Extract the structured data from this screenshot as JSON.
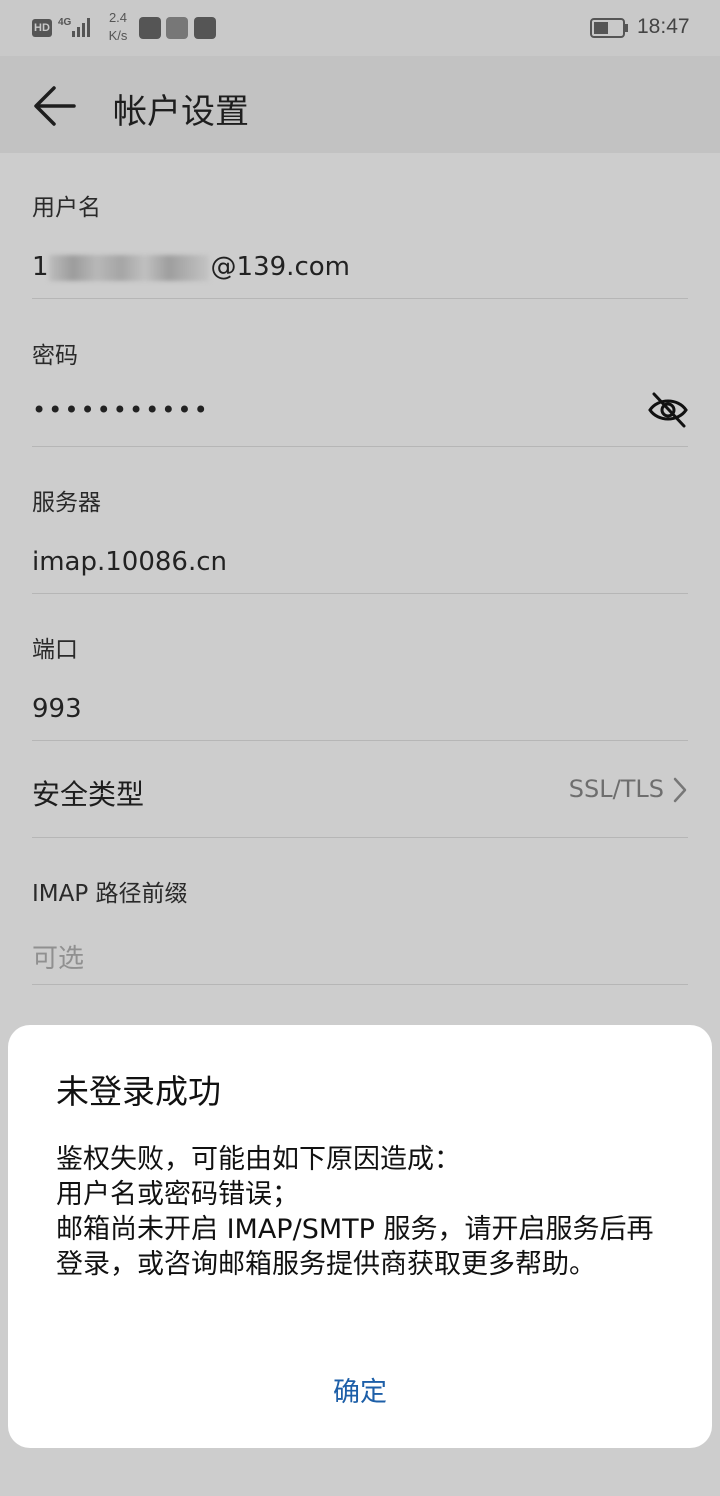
{
  "status_bar": {
    "hd": "HD",
    "network": "4G",
    "speed_value": "2.4",
    "speed_unit": "K/s",
    "time": "18:47"
  },
  "header": {
    "title": "帐户设置",
    "back_icon": "arrow-left-icon"
  },
  "form": {
    "username_label": "用户名",
    "username_prefix": "1",
    "username_domain": "@139.com",
    "password_label": "密码",
    "password_value": "•••••••••••",
    "server_label": "服务器",
    "server_value": "imap.10086.cn",
    "port_label": "端口",
    "port_value": "993",
    "security_label": "安全类型",
    "security_value": "SSL/TLS",
    "imap_prefix_label": "IMAP 路径前缀",
    "imap_prefix_placeholder": "可选"
  },
  "dialog": {
    "title": "未登录成功",
    "body_line1": "鉴权失败，可能由如下原因造成：",
    "body_line2": "用户名或密码错误；",
    "body_line3": "邮箱尚未开启 IMAP/SMTP 服务，请开启服务后再登录，或咨询邮箱服务提供商获取更多帮助。",
    "ok_button": "确定"
  },
  "colors": {
    "dialog_button": "#1d5fa8",
    "overlay_background": "#cdcdcd"
  }
}
